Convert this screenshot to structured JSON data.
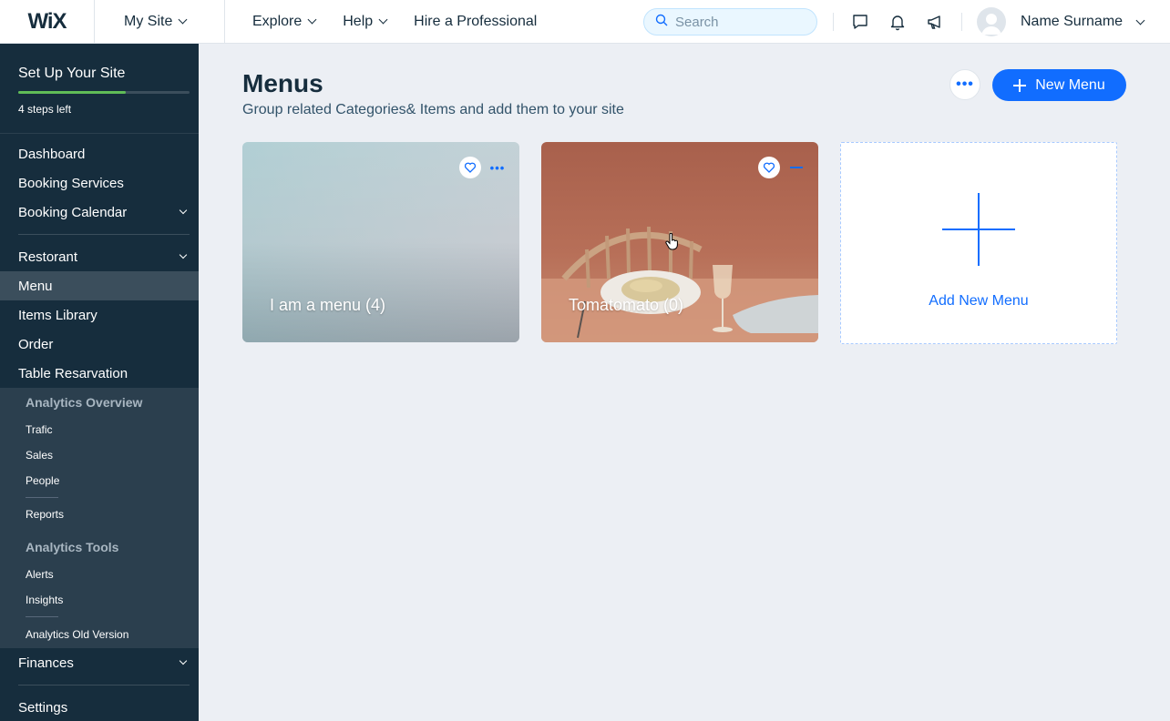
{
  "app": {
    "logo": "WiX",
    "site_switcher": "My Site"
  },
  "nav": {
    "explore": "Explore",
    "help": "Help",
    "hire": "Hire a Professional"
  },
  "search": {
    "placeholder": "Search"
  },
  "user": {
    "name": "Name Surname"
  },
  "sidebar": {
    "setup_title": "Set Up Your Site",
    "steps_left": "4 steps left",
    "progress_fraction": 0.63,
    "items": [
      {
        "label": "Dashboard"
      },
      {
        "label": "Booking Services"
      },
      {
        "label": "Booking Calendar"
      },
      {
        "label": "Restorant"
      },
      {
        "label": "Menu"
      },
      {
        "label": "Items Library"
      },
      {
        "label": "Order"
      },
      {
        "label": "Table Resarvation"
      }
    ],
    "analytics": {
      "overview_head": "Analytics Overview",
      "overview_items": [
        "Trafic",
        "Sales",
        "People"
      ],
      "reports": "Reports",
      "tools_head": "Analytics Tools",
      "tools_items": [
        "Alerts",
        "Insights"
      ],
      "old_version": "Analytics Old Version"
    },
    "finances": "Finances",
    "settings": "Settings"
  },
  "main": {
    "title": "Menus",
    "subtitle": "Group related Categories& Items and add them to your site",
    "new_menu_label": "New Menu",
    "more_label": "•••",
    "cards": [
      {
        "label": "I am a menu (4)"
      },
      {
        "label": "Tomatomato (0)"
      }
    ],
    "add_new_label": "Add New Menu"
  },
  "colors": {
    "accent": "#116dff",
    "sidebar_bg": "#162d3d",
    "progress": "#60bc57",
    "page_bg": "#eceff4"
  }
}
